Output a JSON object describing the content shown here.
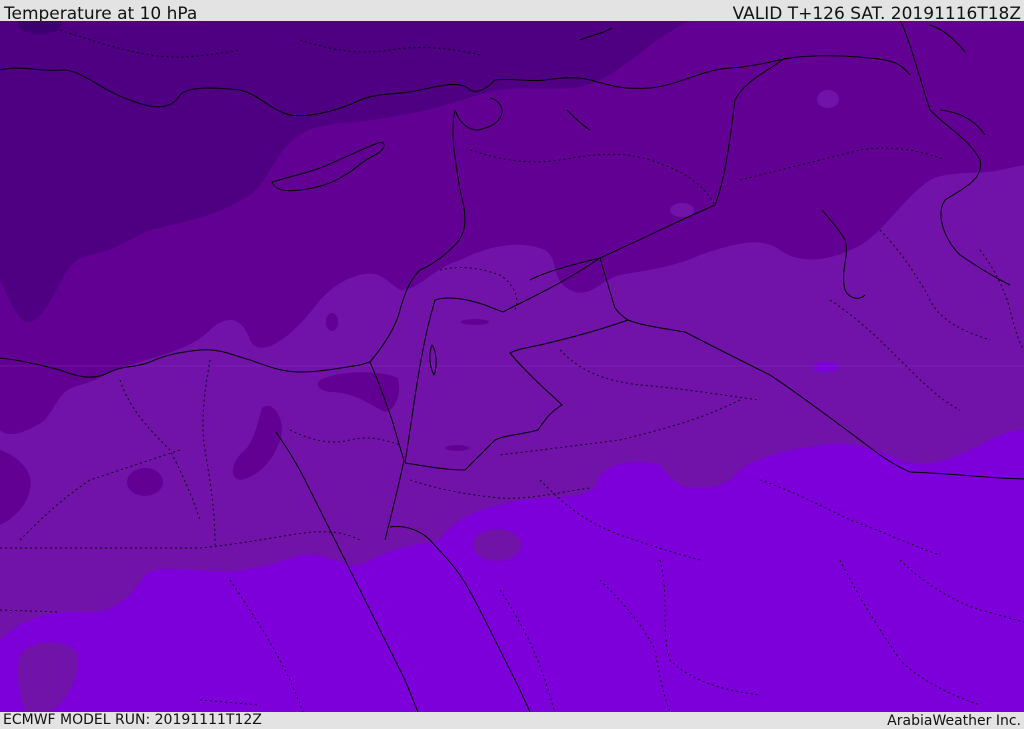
{
  "header": {
    "title": "Temperature at 10 hPa",
    "valid": "VALID T+126 SAT. 20191116T18Z"
  },
  "footer": {
    "model_run": "ECMWF MODEL RUN: 20191111T12Z",
    "brand": "ArabiaWeather Inc."
  },
  "map": {
    "palette": {
      "darkest": "#3d0070",
      "darker": "#4f0082",
      "dark": "#620093",
      "mid": "#7112a9",
      "light": "#7d00da",
      "border": "#000000"
    }
  }
}
